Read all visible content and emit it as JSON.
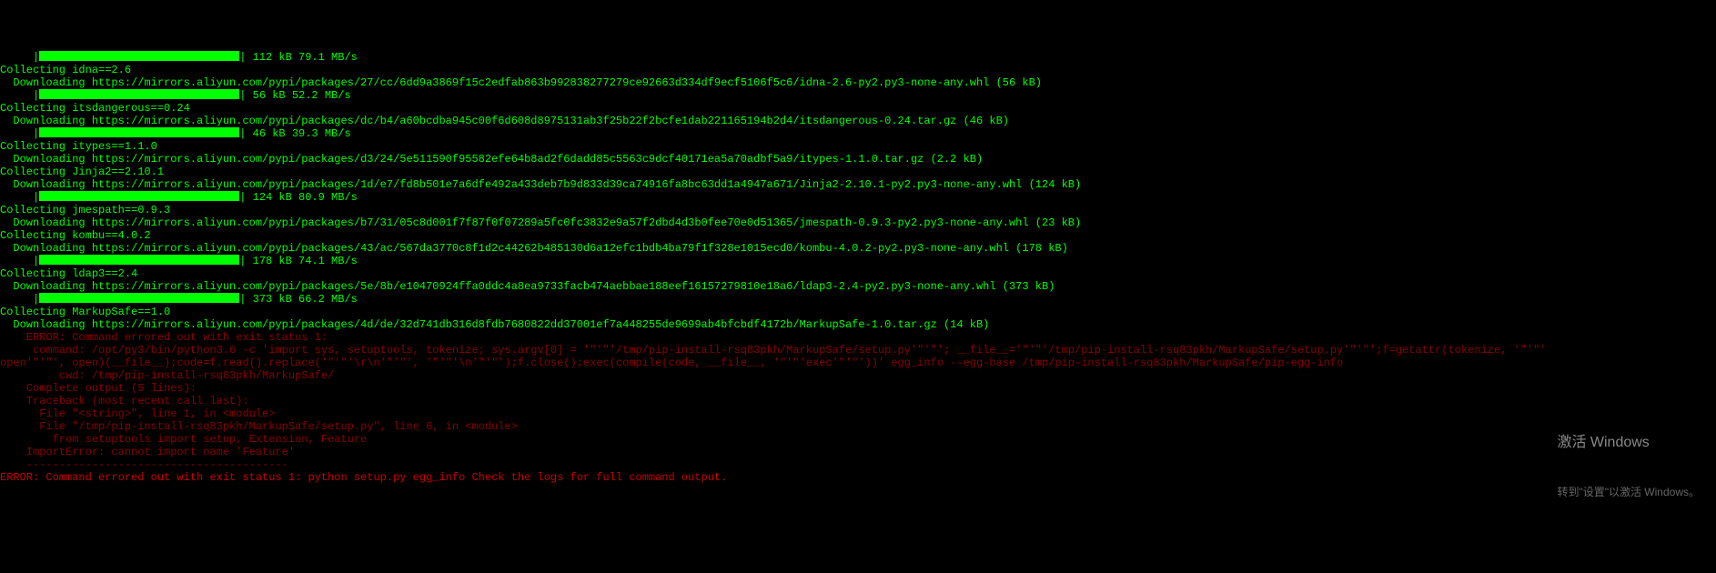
{
  "lines": [
    {
      "cls": "green",
      "indent": "     |",
      "bar": 220,
      "text": "| 112 kB 79.1 MB/s"
    },
    {
      "cls": "green",
      "text": "Collecting idna==2.6"
    },
    {
      "cls": "green",
      "text": "  Downloading https://mirrors.aliyun.com/pypi/packages/27/cc/6dd9a3869f15c2edfab863b992838277279ce92663d334df9ecf5106f5c6/idna-2.6-py2.py3-none-any.whl (56 kB)"
    },
    {
      "cls": "green",
      "indent": "     |",
      "bar": 220,
      "text": "| 56 kB 52.2 MB/s"
    },
    {
      "cls": "green",
      "text": "Collecting itsdangerous==0.24"
    },
    {
      "cls": "green",
      "text": "  Downloading https://mirrors.aliyun.com/pypi/packages/dc/b4/a60bcdba945c00f6d608d8975131ab3f25b22f2bcfe1dab221165194b2d4/itsdangerous-0.24.tar.gz (46 kB)"
    },
    {
      "cls": "green",
      "indent": "     |",
      "bar": 220,
      "text": "| 46 kB 39.3 MB/s"
    },
    {
      "cls": "green",
      "text": "Collecting itypes==1.1.0"
    },
    {
      "cls": "green",
      "text": "  Downloading https://mirrors.aliyun.com/pypi/packages/d3/24/5e511590f95582efe64b8ad2f6dadd85c5563c9dcf40171ea5a70adbf5a9/itypes-1.1.0.tar.gz (2.2 kB)"
    },
    {
      "cls": "green",
      "text": "Collecting Jinja2==2.10.1"
    },
    {
      "cls": "green",
      "text": "  Downloading https://mirrors.aliyun.com/pypi/packages/1d/e7/fd8b501e7a6dfe492a433deb7b9d833d39ca74916fa8bc63dd1a4947a671/Jinja2-2.10.1-py2.py3-none-any.whl (124 kB)"
    },
    {
      "cls": "green",
      "indent": "     |",
      "bar": 220,
      "text": "| 124 kB 80.9 MB/s"
    },
    {
      "cls": "green",
      "text": "Collecting jmespath==0.9.3"
    },
    {
      "cls": "green",
      "text": "  Downloading https://mirrors.aliyun.com/pypi/packages/b7/31/05c8d001f7f87f0f07289a5fc0fc3832e9a57f2dbd4d3b0fee70e0d51365/jmespath-0.9.3-py2.py3-none-any.whl (23 kB)"
    },
    {
      "cls": "green",
      "text": "Collecting kombu==4.0.2"
    },
    {
      "cls": "green",
      "text": "  Downloading https://mirrors.aliyun.com/pypi/packages/43/ac/567da3770c8f1d2c44262b485130d6a12efc1bdb4ba79f1f328e1015ecd0/kombu-4.0.2-py2.py3-none-any.whl (178 kB)"
    },
    {
      "cls": "green",
      "indent": "     |",
      "bar": 220,
      "text": "| 178 kB 74.1 MB/s"
    },
    {
      "cls": "green",
      "text": "Collecting ldap3==2.4"
    },
    {
      "cls": "green",
      "text": "  Downloading https://mirrors.aliyun.com/pypi/packages/5e/8b/e10470924ffa0ddc4a8ea9733facb474aebbae188eef16157279810e18a6/ldap3-2.4-py2.py3-none-any.whl (373 kB)"
    },
    {
      "cls": "green",
      "indent": "     |",
      "bar": 220,
      "text": "| 373 kB 66.2 MB/s"
    },
    {
      "cls": "green",
      "text": "Collecting MarkupSafe==1.0"
    },
    {
      "cls": "green",
      "text": "  Downloading https://mirrors.aliyun.com/pypi/packages/4d/de/32d741db316d8fdb7680822dd37001ef7a448255de9699ab4bfcbdf4172b/MarkupSafe-1.0.tar.gz (14 kB)"
    },
    {
      "cls": "dim-red",
      "text": "    ERROR: Command errored out with exit status 1:"
    },
    {
      "cls": "dim-red",
      "text": "     command: /opt/py3/bin/python3.6 -c 'import sys, setuptools, tokenize; sys.argv[0] = '\"'\"'/tmp/pip-install-rsq83pkh/MarkupSafe/setup.py'\"'\"'; __file__='\"'\"'/tmp/pip-install-rsq83pkh/MarkupSafe/setup.py'\"'\"';f=getattr(tokenize, '\"'\"'"
    },
    {
      "cls": "dim-red",
      "text": "open'\"'\"', open)(__file__);code=f.read().replace('\"'\"'\\r\\n'\"'\"', '\"'\"'\\n'\"'\"');f.close();exec(compile(code, __file__, '\"'\"'exec'\"'\"'))' egg_info --egg-base /tmp/pip-install-rsq83pkh/MarkupSafe/pip-egg-info"
    },
    {
      "cls": "dim-red",
      "text": "         cwd: /tmp/pip-install-rsq83pkh/MarkupSafe/"
    },
    {
      "cls": "dim-red",
      "text": "    Complete output (5 lines):"
    },
    {
      "cls": "dim-red",
      "text": "    Traceback (most recent call last):"
    },
    {
      "cls": "dim-red",
      "text": "      File \"<string>\", line 1, in <module>"
    },
    {
      "cls": "dim-red",
      "text": "      File \"/tmp/pip-install-rsq83pkh/MarkupSafe/setup.py\", line 6, in <module>"
    },
    {
      "cls": "dim-red",
      "text": "        from setuptools import setup, Extension, Feature"
    },
    {
      "cls": "dim-red",
      "text": "    ImportError: cannot import name 'Feature'"
    },
    {
      "cls": "dim-red",
      "text": "    ----------------------------------------"
    },
    {
      "cls": "red",
      "text": "ERROR: Command errored out with exit status 1: python setup.py egg_info Check the logs for full command output."
    }
  ],
  "watermark": {
    "line1": "激活 Windows",
    "line2": "转到\"设置\"以激活 Windows。"
  }
}
